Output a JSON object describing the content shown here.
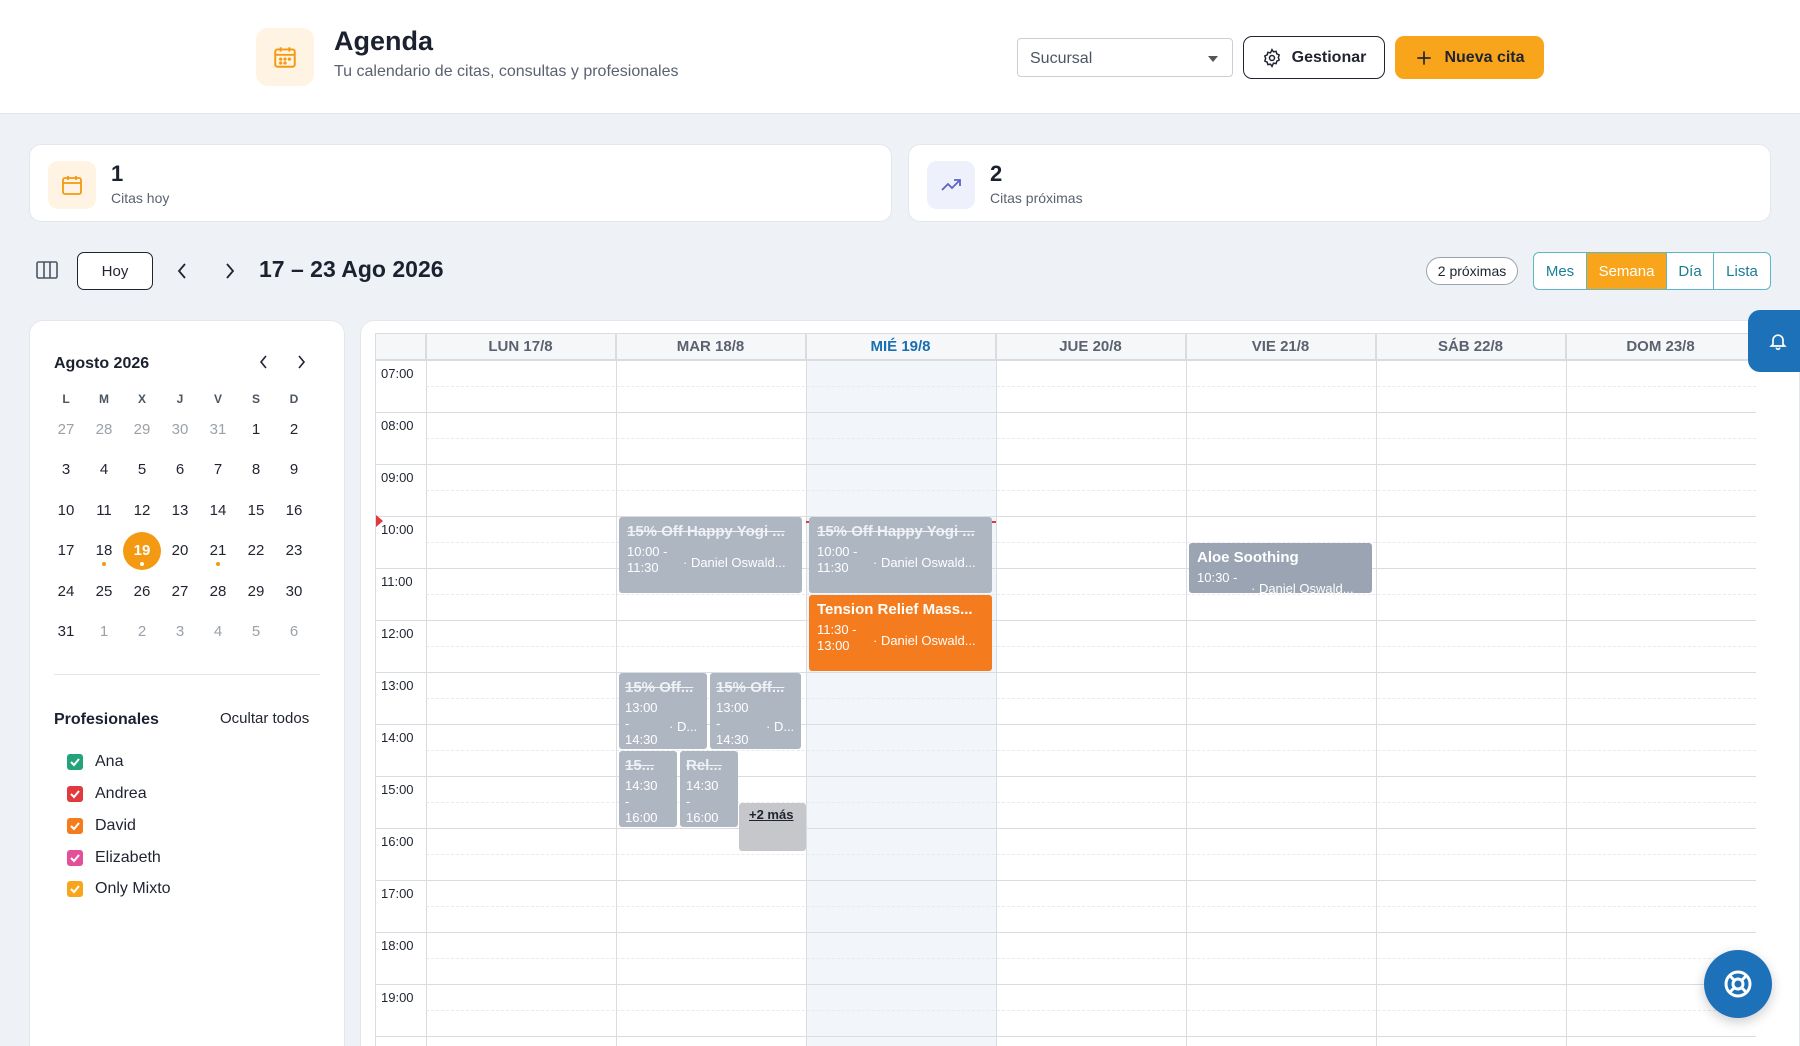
{
  "header": {
    "title": "Agenda",
    "subtitle": "Tu calendario de citas, consultas y profesionales",
    "branch_placeholder": "Sucursal",
    "manage_label": "Gestionar",
    "new_label": "Nueva cita"
  },
  "stats": [
    {
      "value": "1",
      "label": "Citas hoy"
    },
    {
      "value": "2",
      "label": "Citas próximas"
    }
  ],
  "toolbar": {
    "today_label": "Hoy",
    "range": "17 – 23 Ago 2026",
    "upcoming_pill": "2 próximas",
    "views": [
      "Mes",
      "Semana",
      "Día",
      "Lista"
    ],
    "active_view": "Semana"
  },
  "mini_calendar": {
    "title": "Agosto 2026",
    "weekdays": [
      "L",
      "M",
      "X",
      "J",
      "V",
      "S",
      "D"
    ],
    "weeks": [
      [
        "27",
        "28",
        "29",
        "30",
        "31",
        "1",
        "2"
      ],
      [
        "3",
        "4",
        "5",
        "6",
        "7",
        "8",
        "9"
      ],
      [
        "10",
        "11",
        "12",
        "13",
        "14",
        "15",
        "16"
      ],
      [
        "17",
        "18",
        "19",
        "20",
        "21",
        "22",
        "23"
      ],
      [
        "24",
        "25",
        "26",
        "27",
        "28",
        "29",
        "30"
      ],
      [
        "31",
        "1",
        "2",
        "3",
        "4",
        "5",
        "6"
      ]
    ],
    "selected": "19"
  },
  "professionals": {
    "title": "Profesionales",
    "toggle_label": "Ocultar todos",
    "items": [
      {
        "name": "Ana",
        "color": "#22a37a"
      },
      {
        "name": "Andrea",
        "color": "#e0393e"
      },
      {
        "name": "David",
        "color": "#f47c1e"
      },
      {
        "name": "Elizabeth",
        "color": "#e2509a"
      },
      {
        "name": "Only Mixto",
        "color": "#f9a51b"
      }
    ]
  },
  "week": {
    "days": [
      "LUN 17/8",
      "MAR 18/8",
      "MIÉ 19/8",
      "JUE 20/8",
      "VIE 21/8",
      "SÁB 22/8",
      "DOM 23/8"
    ],
    "hours": [
      "07:00",
      "08:00",
      "09:00",
      "10:00",
      "11:00",
      "12:00",
      "13:00",
      "14:00",
      "15:00",
      "16:00",
      "17:00",
      "18:00",
      "19:00"
    ]
  },
  "events": {
    "tue_yoga": {
      "title": "15% Off Happy Yogi ...",
      "time": "10:00 -\n11:30",
      "who": "· Daniel Oswald..."
    },
    "wed_yoga": {
      "title": "15% Off Happy Yogi ...",
      "time": "10:00 -\n11:30",
      "who": "· Daniel Oswald..."
    },
    "wed_tension": {
      "title": "Tension Relief Mass...",
      "time": "11:30 -\n13:00",
      "who": "· Daniel Oswald..."
    },
    "fri_aloe": {
      "title": "Aloe Soothing",
      "time": "10:30 -",
      "who": "· Daniel Oswald..."
    },
    "tue_a": {
      "title": "15% Off...",
      "time": "13:00\n-\n14:30",
      "who": "· D..."
    },
    "tue_b": {
      "title": "15% Off...",
      "time": "13:00\n-\n14:30",
      "who": "· D..."
    },
    "tue_c": {
      "title": "15...",
      "time": "14:30\n-\n16:00"
    },
    "tue_d": {
      "title": "Rel...",
      "time": "14:30\n-\n16:00"
    },
    "more": "+2 más"
  },
  "colors": {
    "accent": "#f9a51b",
    "primary_blue": "#1d71b8",
    "event_orange": "#f47c1e"
  }
}
